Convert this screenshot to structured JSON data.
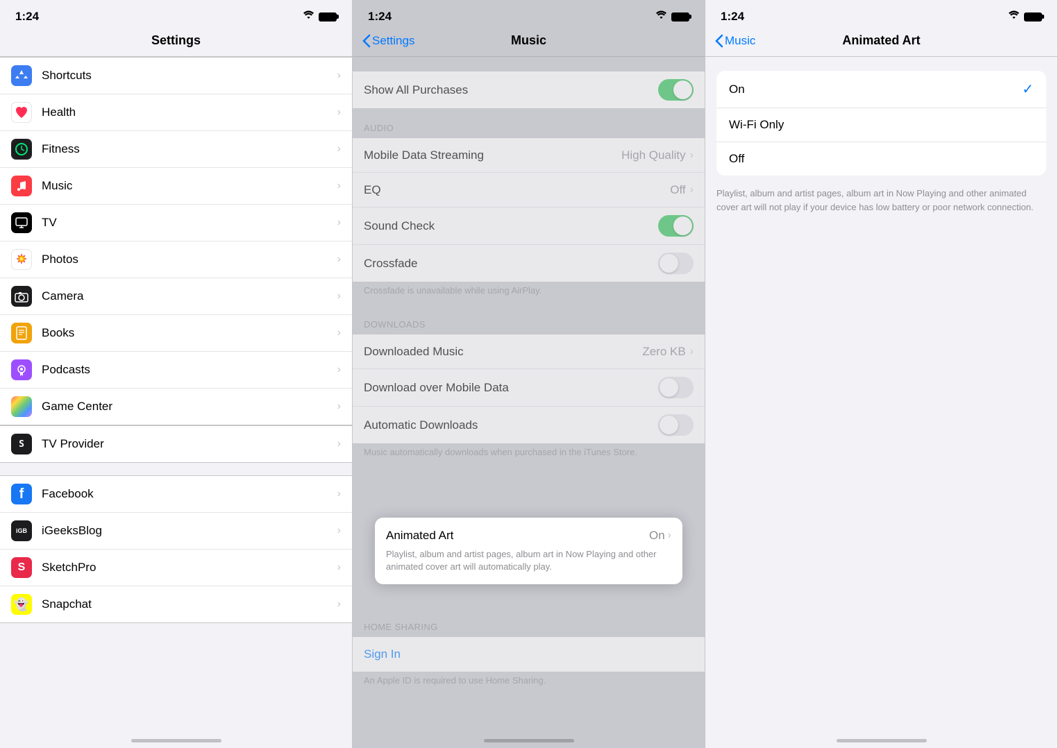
{
  "panel1": {
    "statusTime": "1:24",
    "navTitle": "Settings",
    "items": [
      {
        "id": "shortcuts",
        "label": "Shortcuts",
        "iconBg": "#3c7df2",
        "iconColor": "#fff",
        "iconSymbol": "⌘"
      },
      {
        "id": "health",
        "label": "Health",
        "iconBg": "#ff2d55",
        "iconColor": "#fff",
        "iconSymbol": "❤"
      },
      {
        "id": "fitness",
        "label": "Fitness",
        "iconBg": "#000",
        "iconColor": "#00e676",
        "iconSymbol": "🏃"
      },
      {
        "id": "music",
        "label": "Music",
        "iconBg": "#fc3c44",
        "iconColor": "#fff",
        "iconSymbol": "♫",
        "selected": true
      },
      {
        "id": "tv",
        "label": "TV",
        "iconBg": "#000",
        "iconColor": "#fff",
        "iconSymbol": "▶"
      },
      {
        "id": "photos",
        "label": "Photos",
        "iconBg": "#fff",
        "iconColor": "#000",
        "iconSymbol": "🌸"
      },
      {
        "id": "camera",
        "label": "Camera",
        "iconBg": "#1c1c1e",
        "iconColor": "#fff",
        "iconSymbol": "📷"
      },
      {
        "id": "books",
        "label": "Books",
        "iconBg": "#f0a30a",
        "iconColor": "#fff",
        "iconSymbol": "📖"
      },
      {
        "id": "podcasts",
        "label": "Podcasts",
        "iconBg": "#9d4fff",
        "iconColor": "#fff",
        "iconSymbol": "🎙"
      },
      {
        "id": "gameCenter",
        "label": "Game Center",
        "iconBg": "#fff",
        "iconColor": "#000",
        "iconSymbol": "🎮"
      },
      {
        "id": "tvProvider",
        "label": "TV Provider",
        "iconBg": "#1c1c1e",
        "iconColor": "#fff",
        "iconSymbol": "S"
      },
      {
        "id": "facebook",
        "label": "Facebook",
        "iconBg": "#1877f2",
        "iconColor": "#fff",
        "iconSymbol": "f"
      },
      {
        "id": "iGeeksBlog",
        "label": "iGeeksBlog",
        "iconBg": "#1c1c1e",
        "iconColor": "#fff",
        "iconSymbol": "iGB"
      },
      {
        "id": "sketchPro",
        "label": "SketchPro",
        "iconBg": "#e8294a",
        "iconColor": "#fff",
        "iconSymbol": "S"
      },
      {
        "id": "snapchat",
        "label": "Snapchat",
        "iconBg": "#fffc00",
        "iconColor": "#fff",
        "iconSymbol": "👻"
      }
    ]
  },
  "panel2": {
    "statusTime": "1:24",
    "backLabel": "Settings",
    "navTitle": "Music",
    "sections": {
      "audio": {
        "header": "AUDIO",
        "items": [
          {
            "id": "mobileDataStreaming",
            "label": "Mobile Data Streaming",
            "value": "High Quality"
          },
          {
            "id": "eq",
            "label": "EQ",
            "value": "Off"
          },
          {
            "id": "soundCheck",
            "label": "Sound Check",
            "toggle": true,
            "toggleOn": true
          },
          {
            "id": "crossfade",
            "label": "Crossfade",
            "toggle": true,
            "toggleOn": false
          },
          {
            "id": "crossfadeNote",
            "label": "Crossfade is unavailable while using AirPlay.",
            "isNote": true
          }
        ]
      },
      "downloads": {
        "header": "DOWNLOADS",
        "items": [
          {
            "id": "downloadedMusic",
            "label": "Downloaded Music",
            "value": "Zero KB"
          },
          {
            "id": "downloadOverMobile",
            "label": "Download over Mobile Data",
            "toggle": true,
            "toggleOn": false
          },
          {
            "id": "automaticDownloads",
            "label": "Automatic Downloads",
            "toggle": true,
            "toggleOn": false
          },
          {
            "id": "autoDownloadNote",
            "label": "Music automatically downloads when purchased in the iTunes Store.",
            "isNote": true
          }
        ]
      },
      "animatedArt": {
        "label": "Animated Art",
        "value": "On",
        "desc": "Playlist, album and artist pages, album art in Now Playing and other animated cover art will automatically play."
      },
      "homeSharing": {
        "header": "HOME SHARING",
        "items": [
          {
            "id": "signIn",
            "label": "Sign In",
            "isLink": true
          },
          {
            "id": "homeNote",
            "label": "An Apple ID is required to use Home Sharing.",
            "isNote": true
          }
        ]
      }
    },
    "topItem": {
      "label": "Show All Purchases",
      "toggleOn": true
    }
  },
  "panel3": {
    "statusTime": "1:24",
    "backLabel": "Music",
    "navTitle": "Animated Art",
    "choices": [
      {
        "id": "on",
        "label": "On",
        "selected": true
      },
      {
        "id": "wifiOnly",
        "label": "Wi-Fi Only",
        "selected": false
      },
      {
        "id": "off",
        "label": "Off",
        "selected": false
      }
    ],
    "description": "Playlist, album and artist pages, album art in Now Playing and other animated cover art will not play if your device has low battery or poor network connection."
  }
}
